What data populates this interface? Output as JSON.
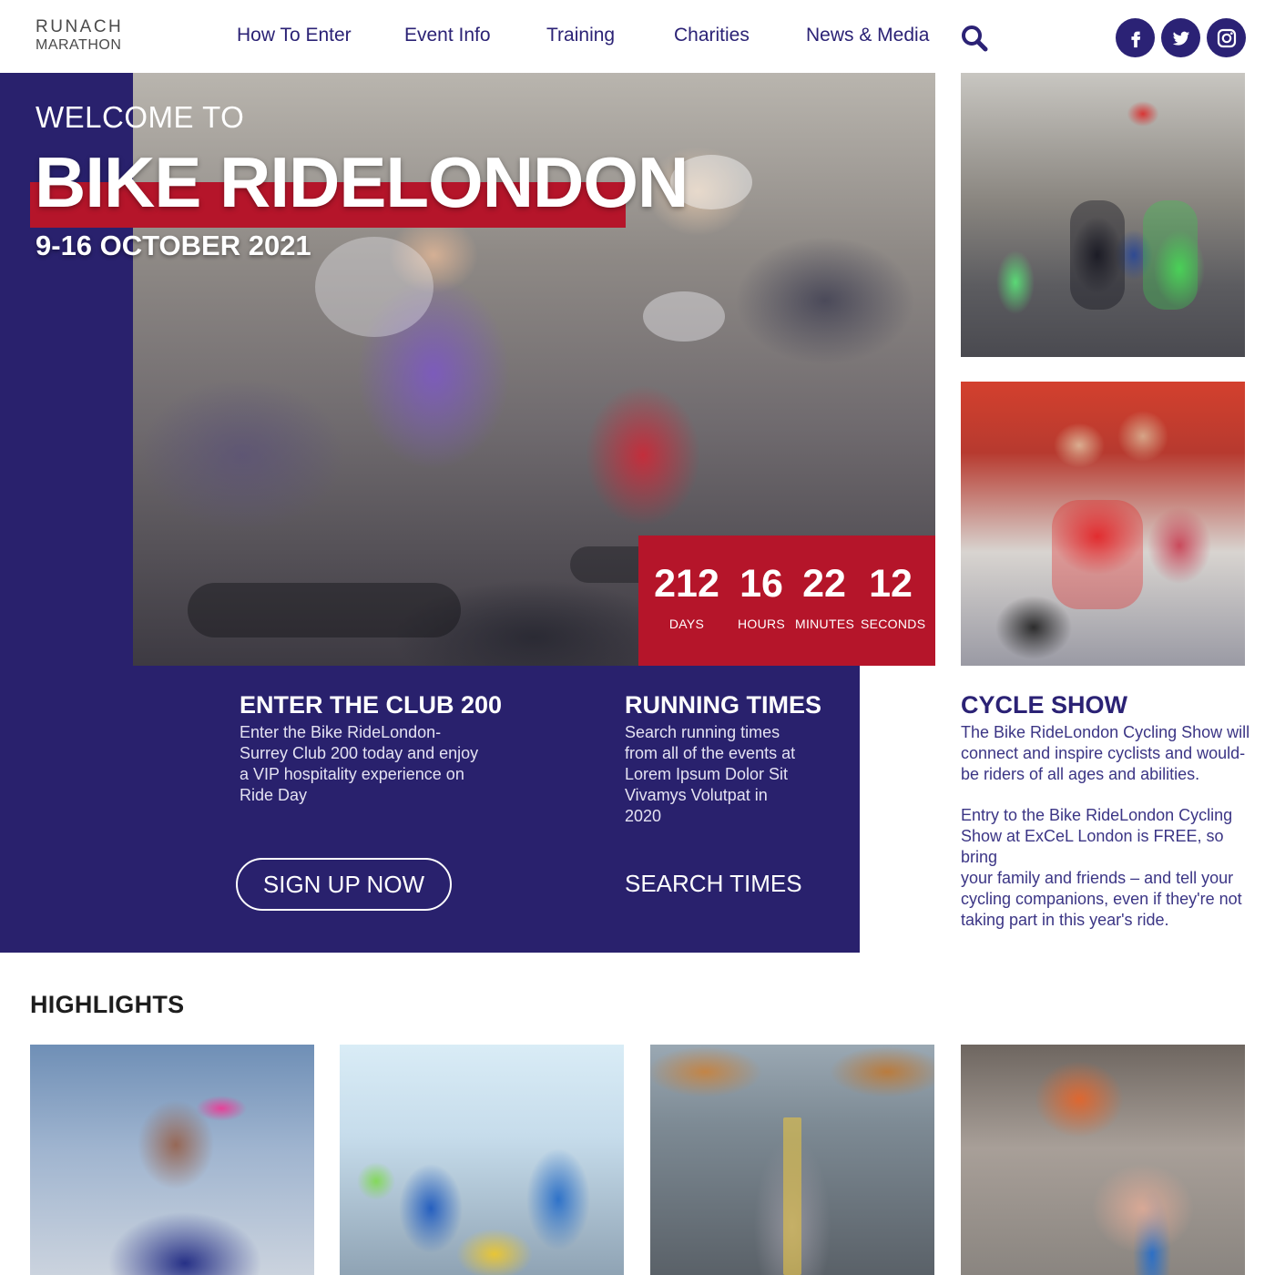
{
  "logo": {
    "line1": "RUNACH",
    "line2": "MARATHON"
  },
  "nav": [
    {
      "label": "How To Enter"
    },
    {
      "label": "Event Info"
    },
    {
      "label": "Training"
    },
    {
      "label": "Charities"
    },
    {
      "label": "News & Media"
    }
  ],
  "social": {
    "facebook": "facebook-icon",
    "twitter": "twitter-icon",
    "instagram": "instagram-icon"
  },
  "colors": {
    "navy": "#29216d",
    "red": "#b5152a",
    "nav_text": "#2b2275"
  },
  "hero": {
    "welcome": "WELCOME TO",
    "title": "BIKE RIDELONDON",
    "date": "9-16 OCTOBER 2021"
  },
  "countdown": [
    {
      "value": "212",
      "label": "DAYS"
    },
    {
      "value": "16",
      "label": "HOURS"
    },
    {
      "value": "22",
      "label": "MINUTES"
    },
    {
      "value": "12",
      "label": "SECONDS"
    }
  ],
  "club": {
    "title": "ENTER THE CLUB 200",
    "lines": [
      "Enter the Bike RideLondon-",
      "Surrey Club 200 today and enjoy",
      "a VIP hospitality experience on",
      "Ride Day"
    ],
    "button": "SIGN UP NOW"
  },
  "times": {
    "title": "RUNNING TIMES",
    "lines": [
      "Search running times",
      "from all of the events at",
      "Lorem Ipsum Dolor Sit",
      "Vivamys Volutpat in",
      "2020"
    ],
    "button": "SEARCH TIMES"
  },
  "cycle": {
    "title": "CYCLE SHOW",
    "para1": [
      "The Bike RideLondon Cycling Show will",
      "connect and inspire cyclists and would-",
      "be riders of all ages and abilities."
    ],
    "para2": [
      "Entry to the Bike RideLondon Cycling",
      "Show at ExCeL London is FREE, so bring",
      "your family and friends – and tell your",
      "cycling companions, even if they're not",
      "taking part in this year's ride."
    ]
  },
  "highlights": {
    "heading": "HIGHLIGHTS"
  }
}
